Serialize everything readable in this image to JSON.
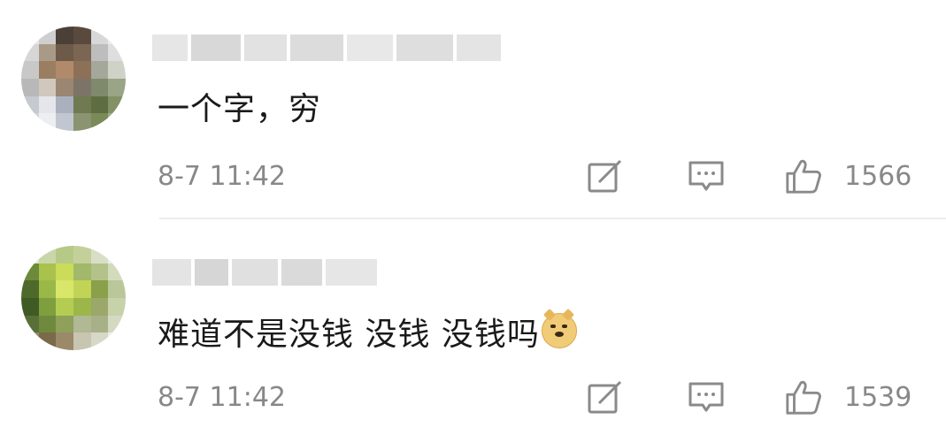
{
  "comments": [
    {
      "avatar_desc": "pixelated-user-photo",
      "username_obscured": true,
      "text": "一个字，穷",
      "timestamp": "8-7 11:42",
      "likes": "1566",
      "has_emoji": false
    },
    {
      "avatar_desc": "pixelated-user-photo",
      "username_obscured": true,
      "text": "难道不是没钱 没钱 没钱吗",
      "timestamp": "8-7 11:42",
      "likes": "1539",
      "has_emoji": true,
      "emoji": "doge-emoji"
    }
  ],
  "icons": {
    "repost": "repost-icon",
    "reply": "comment-icon",
    "like": "thumbs-up-icon"
  },
  "colors": {
    "text": "#1a1a1a",
    "meta": "#888888",
    "icon": "#8a8a8a",
    "divider": "#ececec"
  }
}
